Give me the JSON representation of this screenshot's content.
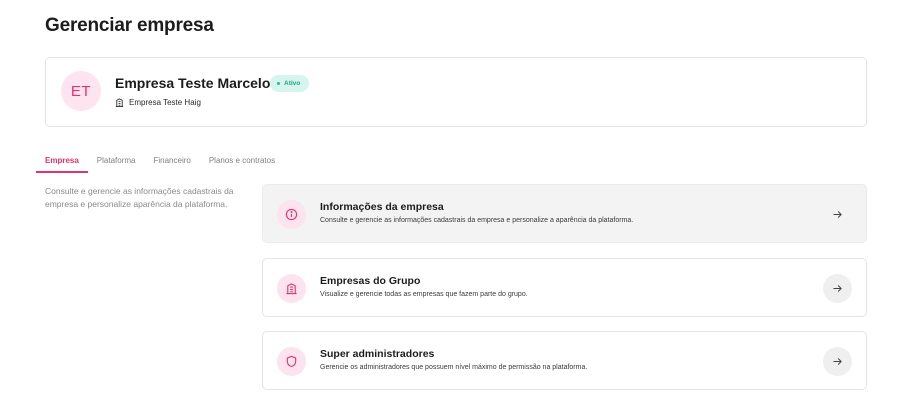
{
  "page": {
    "title": "Gerenciar empresa"
  },
  "company": {
    "avatar_initials": "ET",
    "name": "Empresa Teste Marcelo",
    "status": "Ativo",
    "subcompany": "Empresa Teste Haig",
    "subcompany_icon": "building-icon"
  },
  "tabs": [
    {
      "label": "Empresa",
      "active": true
    },
    {
      "label": "Plataforma",
      "active": false
    },
    {
      "label": "Financeiro",
      "active": false
    },
    {
      "label": "Planos e contratos",
      "active": false
    }
  ],
  "description": "Consulte e gerencie as informações cadastrais da empresa e personalize aparência da plataforma.",
  "options": [
    {
      "title": "Informações da empresa",
      "description": "Consulte e gerencie as informações cadastrais da empresa e personalize a aparência da plataforma.",
      "icon": "info-icon",
      "selected": true
    },
    {
      "title": "Empresas do Grupo",
      "description": "Visualize e gerencie todas as empresas que fazem parte do grupo.",
      "icon": "building-icon",
      "selected": false
    },
    {
      "title": "Super administradores",
      "description": "Gerencie os administradores que possuem nível máximo de permissão na plataforma.",
      "icon": "shield-icon",
      "selected": false
    }
  ],
  "colors": {
    "accent": "#e2336f",
    "accent_soft": "#fde3ed",
    "status_bg": "#d6f5ee",
    "status_text": "#25a486"
  }
}
